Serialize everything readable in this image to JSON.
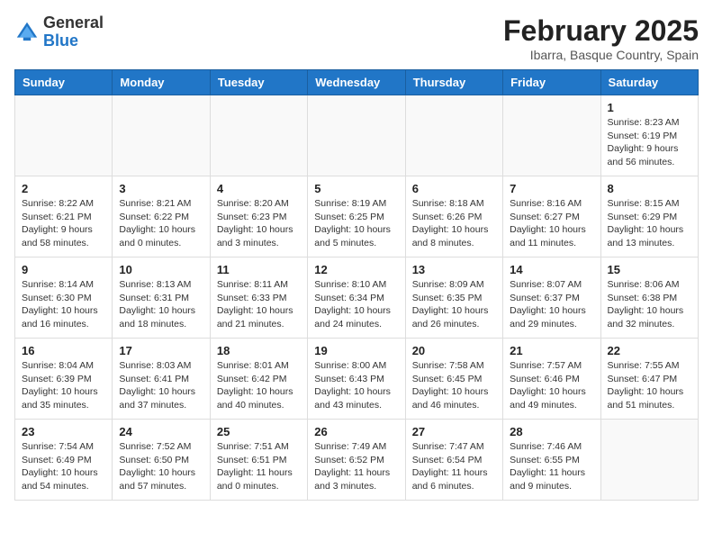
{
  "header": {
    "logo_general": "General",
    "logo_blue": "Blue",
    "month_title": "February 2025",
    "location": "Ibarra, Basque Country, Spain"
  },
  "weekdays": [
    "Sunday",
    "Monday",
    "Tuesday",
    "Wednesday",
    "Thursday",
    "Friday",
    "Saturday"
  ],
  "weeks": [
    [
      {
        "day": "",
        "info": ""
      },
      {
        "day": "",
        "info": ""
      },
      {
        "day": "",
        "info": ""
      },
      {
        "day": "",
        "info": ""
      },
      {
        "day": "",
        "info": ""
      },
      {
        "day": "",
        "info": ""
      },
      {
        "day": "1",
        "info": "Sunrise: 8:23 AM\nSunset: 6:19 PM\nDaylight: 9 hours and 56 minutes."
      }
    ],
    [
      {
        "day": "2",
        "info": "Sunrise: 8:22 AM\nSunset: 6:21 PM\nDaylight: 9 hours and 58 minutes."
      },
      {
        "day": "3",
        "info": "Sunrise: 8:21 AM\nSunset: 6:22 PM\nDaylight: 10 hours and 0 minutes."
      },
      {
        "day": "4",
        "info": "Sunrise: 8:20 AM\nSunset: 6:23 PM\nDaylight: 10 hours and 3 minutes."
      },
      {
        "day": "5",
        "info": "Sunrise: 8:19 AM\nSunset: 6:25 PM\nDaylight: 10 hours and 5 minutes."
      },
      {
        "day": "6",
        "info": "Sunrise: 8:18 AM\nSunset: 6:26 PM\nDaylight: 10 hours and 8 minutes."
      },
      {
        "day": "7",
        "info": "Sunrise: 8:16 AM\nSunset: 6:27 PM\nDaylight: 10 hours and 11 minutes."
      },
      {
        "day": "8",
        "info": "Sunrise: 8:15 AM\nSunset: 6:29 PM\nDaylight: 10 hours and 13 minutes."
      }
    ],
    [
      {
        "day": "9",
        "info": "Sunrise: 8:14 AM\nSunset: 6:30 PM\nDaylight: 10 hours and 16 minutes."
      },
      {
        "day": "10",
        "info": "Sunrise: 8:13 AM\nSunset: 6:31 PM\nDaylight: 10 hours and 18 minutes."
      },
      {
        "day": "11",
        "info": "Sunrise: 8:11 AM\nSunset: 6:33 PM\nDaylight: 10 hours and 21 minutes."
      },
      {
        "day": "12",
        "info": "Sunrise: 8:10 AM\nSunset: 6:34 PM\nDaylight: 10 hours and 24 minutes."
      },
      {
        "day": "13",
        "info": "Sunrise: 8:09 AM\nSunset: 6:35 PM\nDaylight: 10 hours and 26 minutes."
      },
      {
        "day": "14",
        "info": "Sunrise: 8:07 AM\nSunset: 6:37 PM\nDaylight: 10 hours and 29 minutes."
      },
      {
        "day": "15",
        "info": "Sunrise: 8:06 AM\nSunset: 6:38 PM\nDaylight: 10 hours and 32 minutes."
      }
    ],
    [
      {
        "day": "16",
        "info": "Sunrise: 8:04 AM\nSunset: 6:39 PM\nDaylight: 10 hours and 35 minutes."
      },
      {
        "day": "17",
        "info": "Sunrise: 8:03 AM\nSunset: 6:41 PM\nDaylight: 10 hours and 37 minutes."
      },
      {
        "day": "18",
        "info": "Sunrise: 8:01 AM\nSunset: 6:42 PM\nDaylight: 10 hours and 40 minutes."
      },
      {
        "day": "19",
        "info": "Sunrise: 8:00 AM\nSunset: 6:43 PM\nDaylight: 10 hours and 43 minutes."
      },
      {
        "day": "20",
        "info": "Sunrise: 7:58 AM\nSunset: 6:45 PM\nDaylight: 10 hours and 46 minutes."
      },
      {
        "day": "21",
        "info": "Sunrise: 7:57 AM\nSunset: 6:46 PM\nDaylight: 10 hours and 49 minutes."
      },
      {
        "day": "22",
        "info": "Sunrise: 7:55 AM\nSunset: 6:47 PM\nDaylight: 10 hours and 51 minutes."
      }
    ],
    [
      {
        "day": "23",
        "info": "Sunrise: 7:54 AM\nSunset: 6:49 PM\nDaylight: 10 hours and 54 minutes."
      },
      {
        "day": "24",
        "info": "Sunrise: 7:52 AM\nSunset: 6:50 PM\nDaylight: 10 hours and 57 minutes."
      },
      {
        "day": "25",
        "info": "Sunrise: 7:51 AM\nSunset: 6:51 PM\nDaylight: 11 hours and 0 minutes."
      },
      {
        "day": "26",
        "info": "Sunrise: 7:49 AM\nSunset: 6:52 PM\nDaylight: 11 hours and 3 minutes."
      },
      {
        "day": "27",
        "info": "Sunrise: 7:47 AM\nSunset: 6:54 PM\nDaylight: 11 hours and 6 minutes."
      },
      {
        "day": "28",
        "info": "Sunrise: 7:46 AM\nSunset: 6:55 PM\nDaylight: 11 hours and 9 minutes."
      },
      {
        "day": "",
        "info": ""
      }
    ]
  ]
}
